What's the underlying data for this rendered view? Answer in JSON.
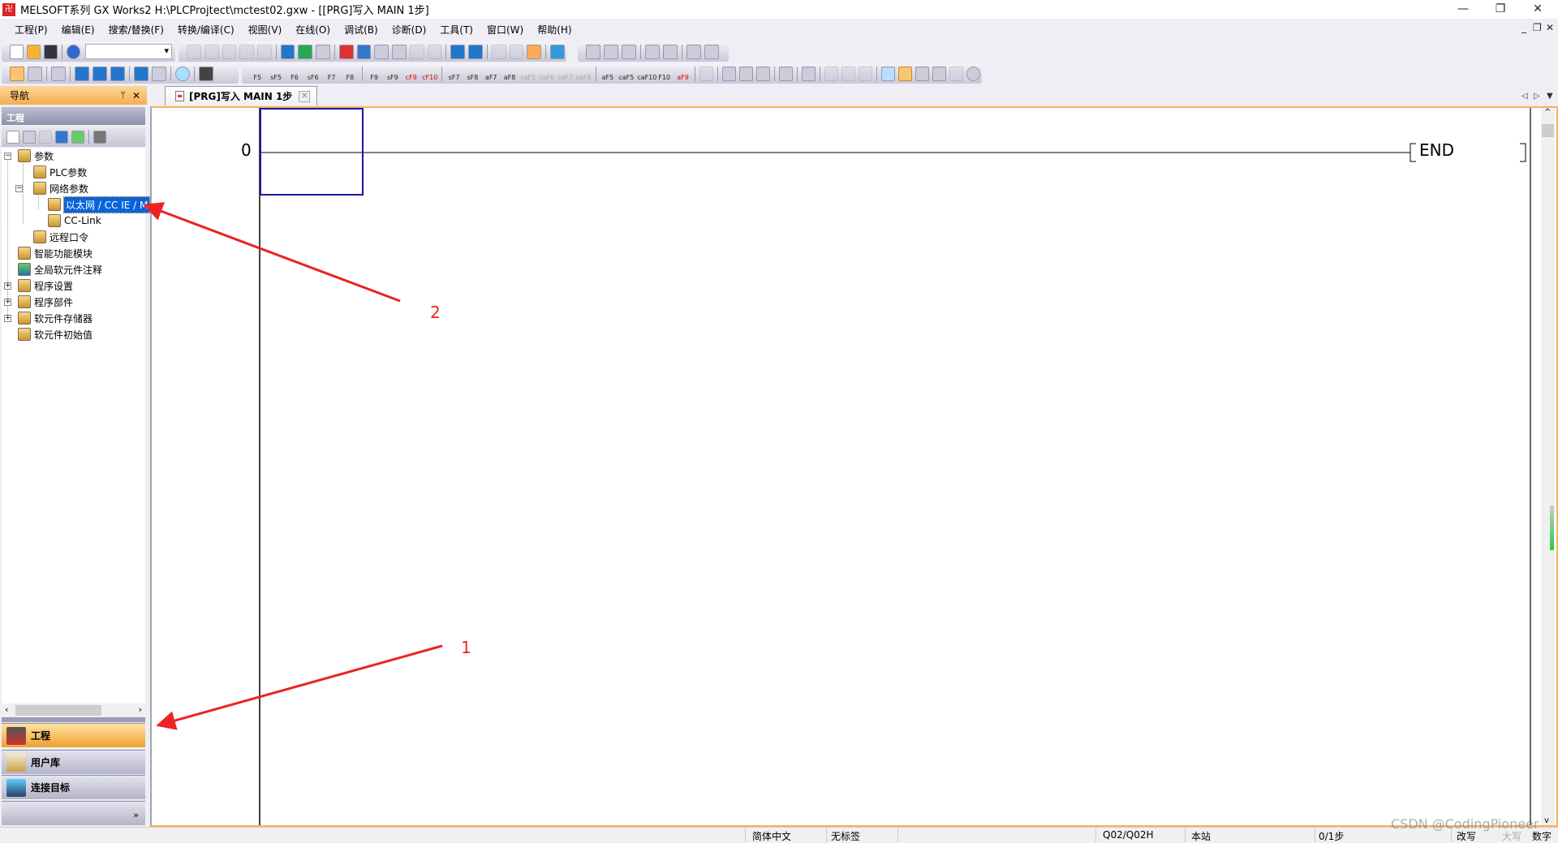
{
  "window": {
    "title": "MELSOFT系列 GX Works2 H:\\PLCProjtect\\mctest02.gxw - [[PRG]写入 MAIN 1步]",
    "minimize": "—",
    "restore": "❐",
    "close": "✕"
  },
  "menu": [
    "工程(P)",
    "编辑(E)",
    "搜索/替换(F)",
    "转换/编译(C)",
    "视图(V)",
    "在线(O)",
    "调试(B)",
    "诊断(D)",
    "工具(T)",
    "窗口(W)",
    "帮助(H)"
  ],
  "mdi_controls": {
    "minimize": "_",
    "restore": "❐",
    "close": "✕"
  },
  "toolbar_keys": [
    "F5",
    "sF5",
    "F6",
    "sF6",
    "F7",
    "F8",
    "F9",
    "sF9",
    "cF9",
    "cF10",
    "sF7",
    "sF8",
    "aF7",
    "aF8",
    "saF5",
    "saF6",
    "saF7",
    "saF8",
    "aF5",
    "caF5",
    "caF10",
    "F10",
    "aF9"
  ],
  "navigation": {
    "title": "导航",
    "pin": "ᛘ",
    "close": "✕",
    "section": "工程",
    "tree": [
      {
        "label": "参数",
        "level": 0,
        "expander": "−"
      },
      {
        "label": "PLC参数",
        "level": 1
      },
      {
        "label": "网络参数",
        "level": 1,
        "expander": "−"
      },
      {
        "label": "以太网 / CC IE / M",
        "level": 2,
        "selected": true
      },
      {
        "label": "CC-Link",
        "level": 2
      },
      {
        "label": "远程口令",
        "level": 1
      },
      {
        "label": "智能功能模块",
        "level": 0
      },
      {
        "label": "全局软元件注释",
        "level": 0
      },
      {
        "label": "程序设置",
        "level": 0,
        "expander": "+"
      },
      {
        "label": "程序部件",
        "level": 0,
        "expander": "+"
      },
      {
        "label": "软元件存储器",
        "level": 0,
        "expander": "+"
      },
      {
        "label": "软元件初始值",
        "level": 0
      }
    ],
    "buttons": [
      {
        "label": "工程",
        "active": true
      },
      {
        "label": "用户库"
      },
      {
        "label": "连接目标"
      }
    ],
    "more": "»"
  },
  "editor": {
    "tab_label": "[PRG]写入 MAIN 1步",
    "tab_icon": "ladder-icon",
    "tab_close": "✕",
    "step": "0",
    "end_instruction": "END"
  },
  "annotations": {
    "arrow1_label": "1",
    "arrow2_label": "2",
    "color": "#ee2222"
  },
  "status": {
    "language": "简体中文",
    "label": "无标签",
    "cpu": "Q02/Q02H",
    "station": "本站",
    "steps": "0/1步",
    "mode": "改写",
    "caps": "大写",
    "num": "数字"
  },
  "watermark": "CSDN @CodingPioneer"
}
